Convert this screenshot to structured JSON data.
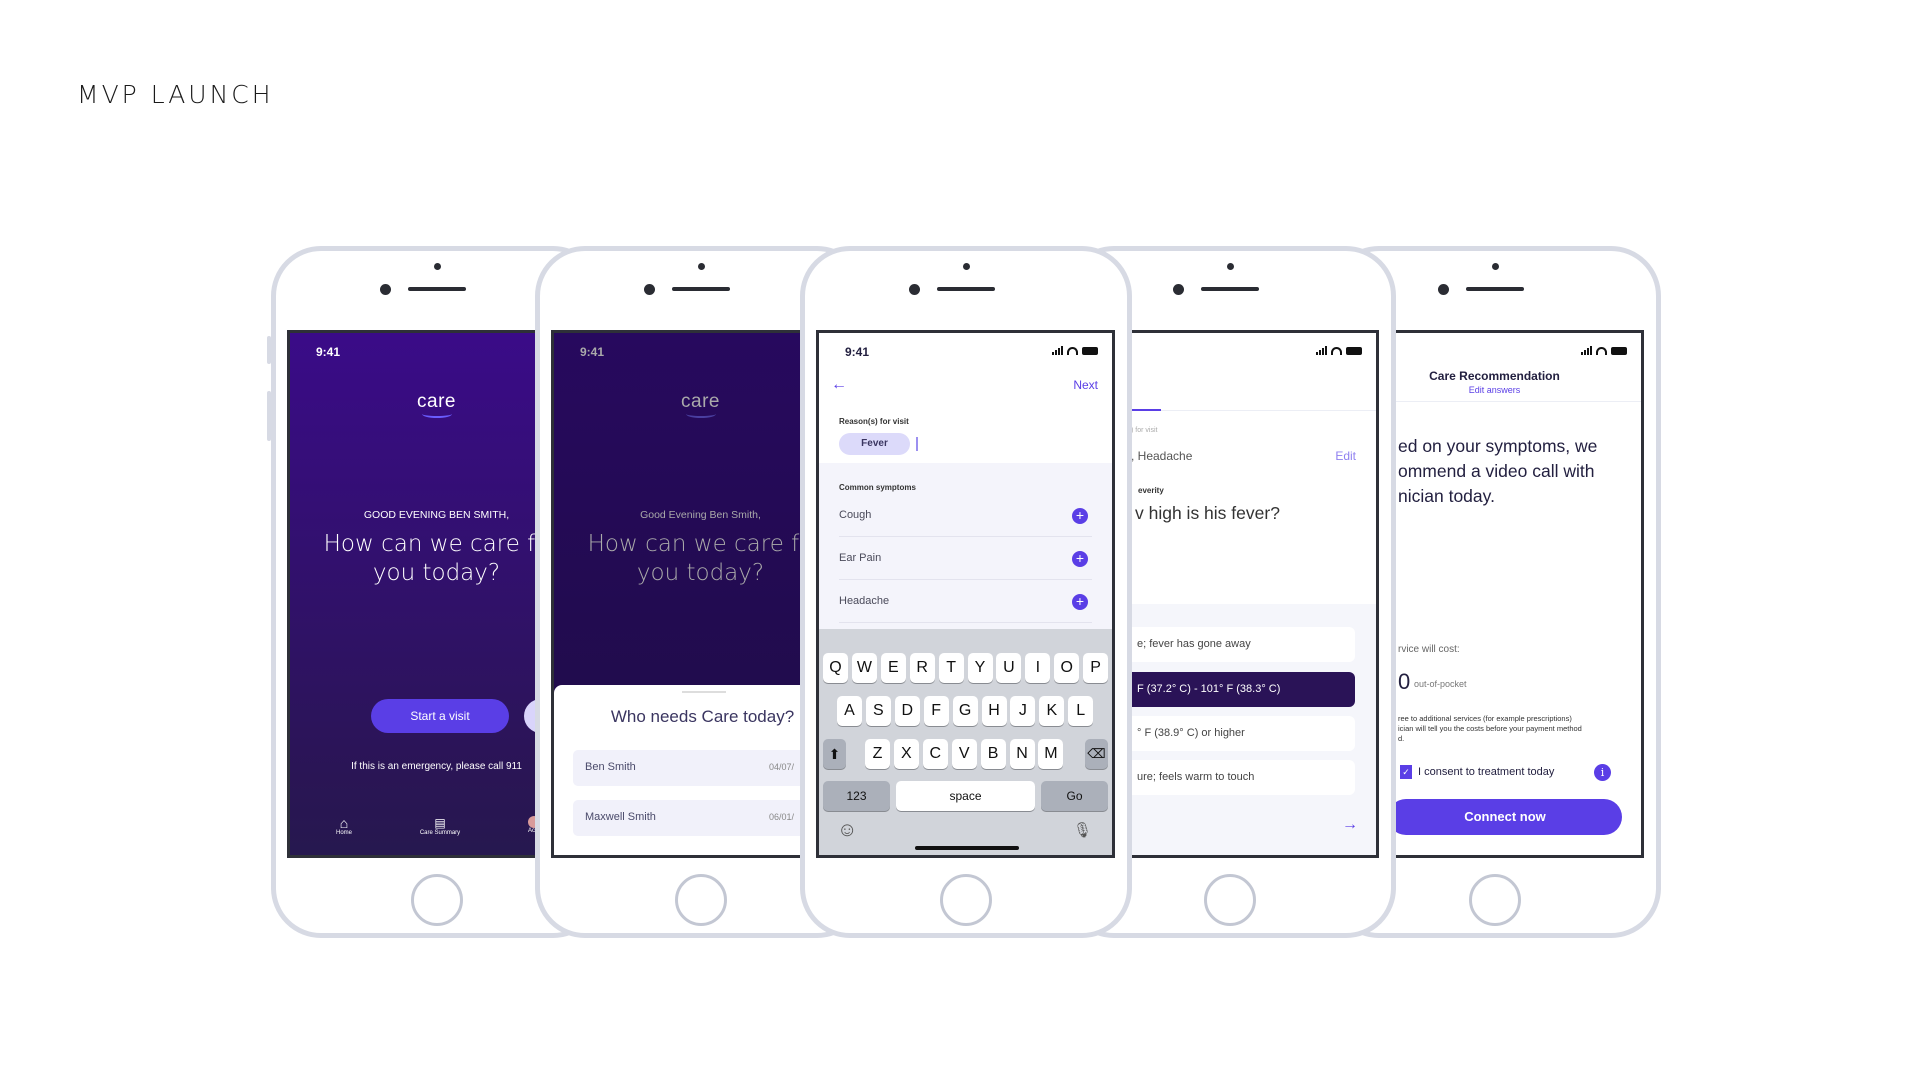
{
  "page_title": "MVP LAUNCH",
  "status_time": "9:41",
  "colors": {
    "accent": "#5a3ee6",
    "dark_purple": "#2a1357",
    "home_bg": "#3a0b88",
    "sheet_row": "#f1f1fa"
  },
  "phone1": {
    "logo": "care",
    "greeting": "GOOD EVENING BEN SMITH,",
    "headline_1": "How can we care fo",
    "headline_2": "you today?",
    "start_button": "Start a visit",
    "emergency": "If this is an emergency, please call 911",
    "tabs": [
      {
        "label": "Home",
        "icon": "home-icon"
      },
      {
        "label": "Care Summary",
        "icon": "document-icon"
      },
      {
        "label": "Ac",
        "icon": "avatar-icon"
      }
    ]
  },
  "phone2": {
    "logo": "care",
    "greeting": "Good Evening Ben Smith,",
    "headline_1": "How can we care fo",
    "headline_2": "you today?",
    "sheet_title": "Who needs Care today?",
    "people": [
      {
        "name": "Ben Smith",
        "date": "04/07/"
      },
      {
        "name": "Maxwell Smith",
        "date": "06/01/"
      }
    ]
  },
  "phone3": {
    "next": "Next",
    "reason_label": "Reason(s) for visit",
    "chip": "Fever",
    "common_label": "Common symptoms",
    "symptoms": [
      "Cough",
      "Ear Pain",
      "Headache"
    ],
    "keyboard": {
      "row1": [
        "Q",
        "W",
        "E",
        "R",
        "T",
        "Y",
        "U",
        "I",
        "O",
        "P"
      ],
      "row2": [
        "A",
        "S",
        "D",
        "F",
        "G",
        "H",
        "J",
        "K",
        "L"
      ],
      "row3": [
        "Z",
        "X",
        "C",
        "V",
        "B",
        "N",
        "M"
      ],
      "numbers": "123",
      "space": "space",
      "go": "Go"
    }
  },
  "phone4": {
    "reason_label": ") for visit",
    "reasons": ", Headache",
    "edit": "Edit",
    "severity_label": "everity",
    "question": "v high is his fever?",
    "options": [
      "e; fever has gone away",
      "F (37.2° C) - 101° F (38.3° C)",
      "° F (38.9° C) or higher",
      "ure; feels warm to touch"
    ],
    "selected_option": 1
  },
  "phone5": {
    "title": "Care Recommendation",
    "edit_answers": "Edit answers",
    "rec_1": "ed on your symptoms, we",
    "rec_2": "ommend a video call with",
    "rec_3": "nician today.",
    "cost_label": "rvice will cost:",
    "price": "0",
    "price_note": "out-of-pocket",
    "fine_1": "ree to additional services (for example prescriptions)",
    "fine_2": "ician will tell you the costs before your payment method",
    "fine_3": "d.",
    "consent": "I consent to treatment today",
    "consent_checked": true,
    "connect": "Connect now"
  }
}
